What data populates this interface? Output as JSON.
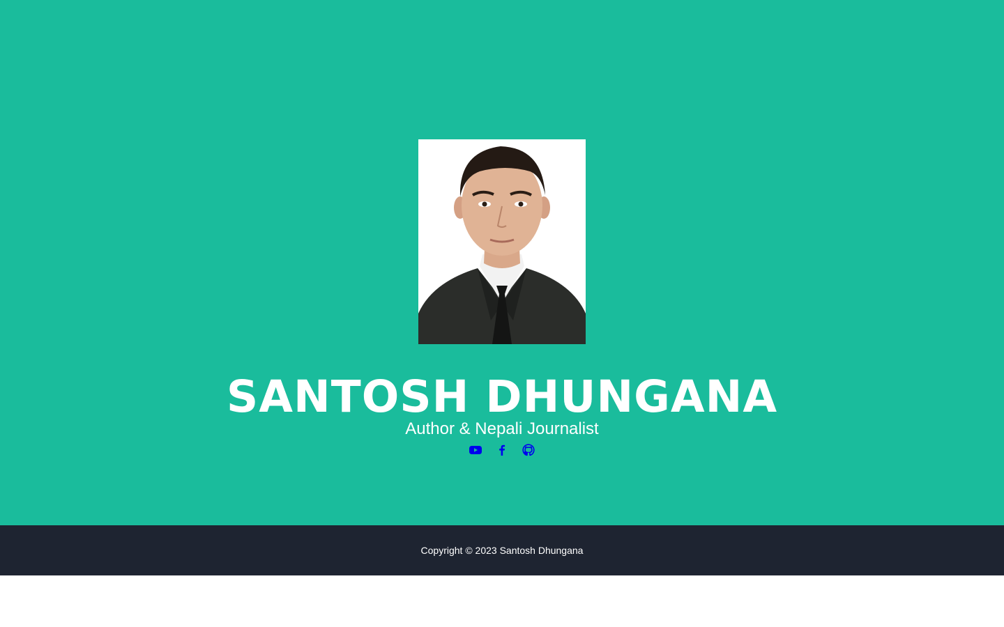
{
  "hero": {
    "background_color": "#1abc9c",
    "portrait_alt": "profile photo",
    "name": "SANTOSH DHUNGANA",
    "subtitle": "Author & Nepali Journalist",
    "social_links": [
      {
        "icon": "youtube-icon",
        "color": "#0000ee"
      },
      {
        "icon": "facebook-icon",
        "color": "#0000ee"
      },
      {
        "icon": "github-icon",
        "color": "#0000ee"
      }
    ]
  },
  "footer": {
    "background_color": "#1e2431",
    "copyright": "Copyright © 2023 Santosh Dhungana"
  }
}
